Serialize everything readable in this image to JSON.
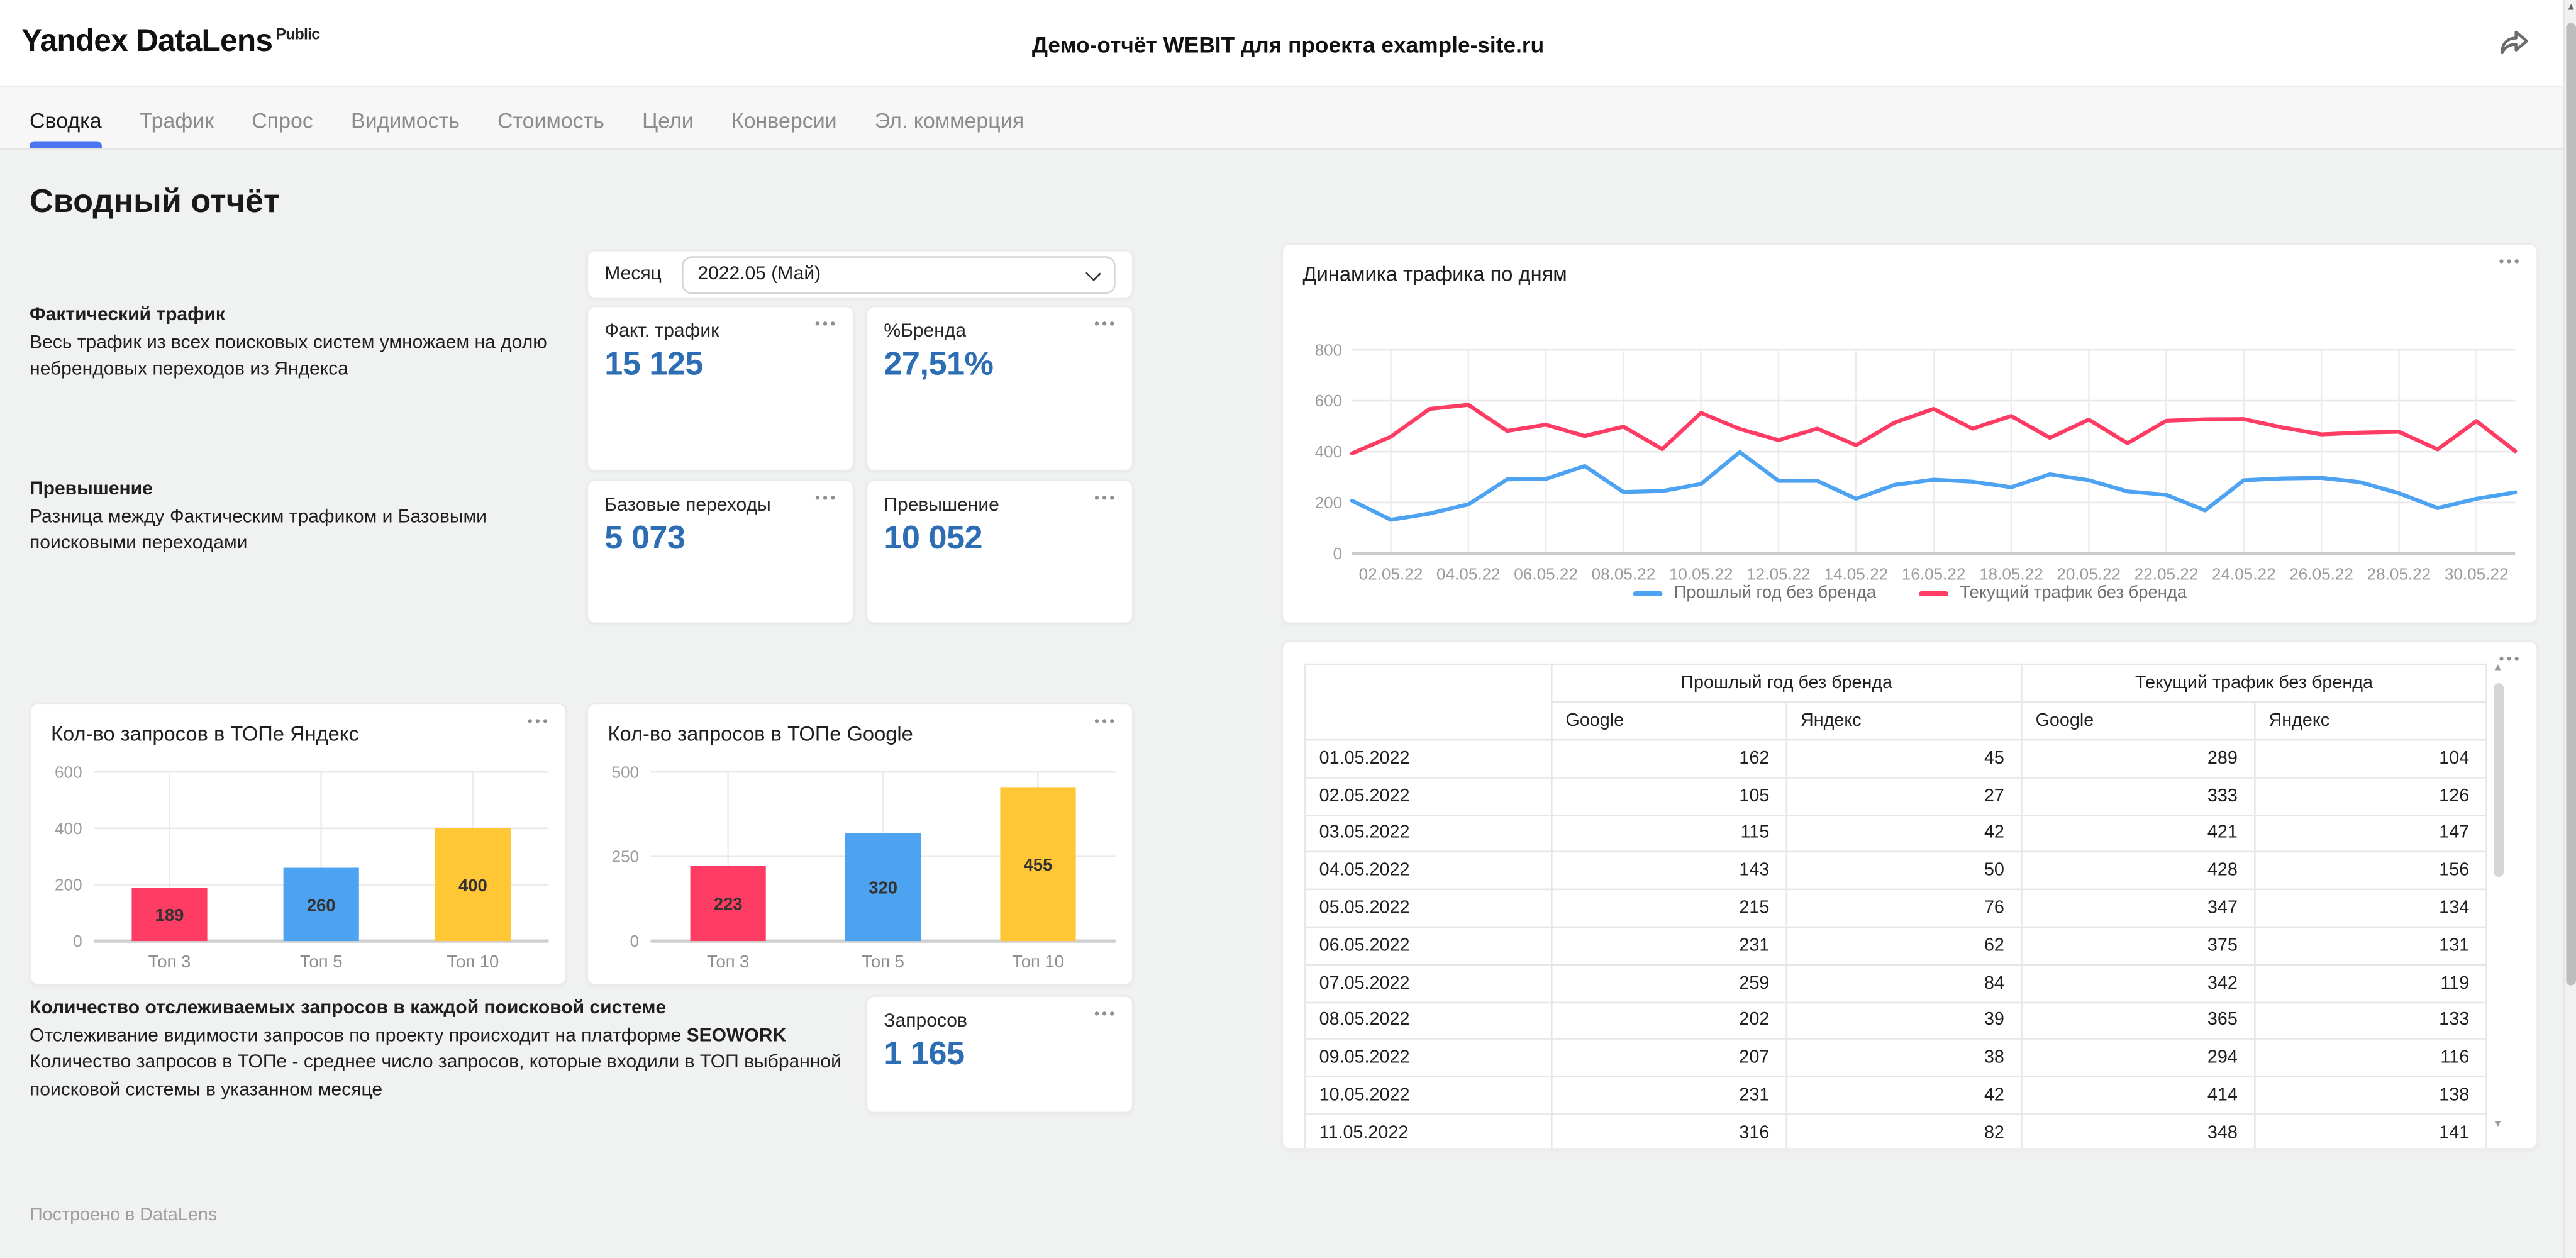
{
  "header": {
    "logo": "Yandex DataLens",
    "logo_badge": "Public",
    "title": "Демо-отчёт WEBIT для проекта example-site.ru"
  },
  "icons": {
    "more_menu": "•••",
    "chevron_down": "chevron-css-shape",
    "share": "curved-arrow-svg",
    "scroll_up": "▲",
    "scroll_down": "▼"
  },
  "colors": {
    "accent": "#4a74f0",
    "kpi_value": "#2c6db4",
    "series_blue": "#4DA2F1",
    "series_red": "#FF3D64",
    "series_yellow": "#FFC636"
  },
  "tabs": [
    {
      "label": "Сводка",
      "active": true
    },
    {
      "label": "Трафик",
      "active": false
    },
    {
      "label": "Спрос",
      "active": false
    },
    {
      "label": "Видимость",
      "active": false
    },
    {
      "label": "Стоимость",
      "active": false
    },
    {
      "label": "Цели",
      "active": false
    },
    {
      "label": "Конверсии",
      "active": false
    },
    {
      "label": "Эл. коммерция",
      "active": false
    }
  ],
  "page_title": "Сводный отчёт",
  "filter": {
    "label": "Месяц",
    "value": "2022.05 (Май)"
  },
  "notes": {
    "fact": {
      "title": "Фактический трафик",
      "body": "Весь трафик из всех поисковых систем умножаем на долю небрендовых переходов из Яндекса"
    },
    "exceed": {
      "title": "Превышение",
      "body": "Разница между Фактическим трафиком и Базовыми поисковыми переходами"
    },
    "queries": {
      "title": "Количество отслеживаемых запросов в каждой поисковой системе",
      "body_prefix": "Отслеживание видимости запросов по проекту происходит на платформе ",
      "body_bold": "SEOWORK",
      "body_rest": "Количество запросов в ТОПе - среднее число запросов, которые входили в ТОП выбранной поисковой системы в указанном месяце"
    }
  },
  "kpi_fact": {
    "label": "Факт. трафик",
    "value": "15 125"
  },
  "kpi_brand": {
    "label": "%Бренда",
    "value": "27,51%"
  },
  "kpi_base": {
    "label": "Базовые переходы",
    "value": "5 073"
  },
  "kpi_exceed": {
    "label": "Превышение",
    "value": "10 052"
  },
  "kpi_queries": {
    "label": "Запросов",
    "value": "1 165"
  },
  "chart_data": [
    {
      "type": "line",
      "title": "Динамика трафика по дням",
      "x": [
        "01.05.22",
        "02.05.22",
        "03.05.22",
        "04.05.22",
        "05.05.22",
        "06.05.22",
        "07.05.22",
        "08.05.22",
        "09.05.22",
        "10.05.22",
        "11.05.22",
        "12.05.22",
        "13.05.22",
        "14.05.22",
        "15.05.22",
        "16.05.22",
        "17.05.22",
        "18.05.22",
        "19.05.22",
        "20.05.22",
        "21.05.22",
        "22.05.22",
        "23.05.22",
        "24.05.22",
        "25.05.22",
        "26.05.22",
        "27.05.22",
        "28.05.22",
        "29.05.22",
        "30.05.22",
        "31.05.22"
      ],
      "x_tick_labels": [
        "02.05.22",
        "04.05.22",
        "06.05.22",
        "08.05.22",
        "10.05.22",
        "12.05.22",
        "14.05.22",
        "16.05.22",
        "18.05.22",
        "20.05.22",
        "22.05.22",
        "24.05.22",
        "26.05.22",
        "28.05.22",
        "30.05.22"
      ],
      "series": [
        {
          "name": "Прошлый год без бренда",
          "color": "#4DA2F1",
          "values": [
            207,
            132,
            157,
            193,
            291,
            293,
            343,
            241,
            245,
            273,
            398,
            285,
            285,
            215,
            270,
            290,
            282,
            260,
            311,
            288,
            244,
            230,
            169,
            288,
            295,
            297,
            280,
            237,
            178,
            215,
            240
          ]
        },
        {
          "name": "Текущий трафик без бренда",
          "color": "#FF3D64",
          "values": [
            393,
            459,
            568,
            584,
            481,
            506,
            461,
            498,
            410,
            552,
            489,
            445,
            490,
            425,
            515,
            568,
            490,
            540,
            454,
            526,
            433,
            521,
            527,
            528,
            495,
            468,
            475,
            478,
            409,
            520,
            402
          ]
        }
      ],
      "ylim": [
        0,
        800
      ],
      "yticks": [
        0,
        200,
        400,
        600,
        800
      ],
      "grid": true,
      "legend_position": "bottom"
    },
    {
      "type": "bar",
      "title": "Кол-во запросов в ТОПе Яндекс",
      "categories": [
        "Топ 3",
        "Топ 5",
        "Топ 10"
      ],
      "values": [
        189,
        260,
        400
      ],
      "bar_colors": [
        "#FF3D64",
        "#4DA2F1",
        "#FFC636"
      ],
      "ylim": [
        0,
        600
      ],
      "yticks": [
        0,
        200,
        400,
        600
      ]
    },
    {
      "type": "bar",
      "title": "Кол-во запросов в ТОПе Google",
      "categories": [
        "Топ 3",
        "Топ 5",
        "Топ 10"
      ],
      "values": [
        223,
        320,
        455
      ],
      "bar_colors": [
        "#FF3D64",
        "#4DA2F1",
        "#FFC636"
      ],
      "ylim": [
        0,
        500
      ],
      "yticks": [
        0,
        250,
        500
      ]
    },
    {
      "type": "table",
      "column_groups": [
        "",
        "Прошлый год без бренда",
        "Текущий трафик без бренда"
      ],
      "columns": [
        "",
        "Google",
        "Яндекс",
        "Google",
        "Яндекс"
      ],
      "rows": [
        [
          "01.05.2022",
          "162",
          "45",
          "289",
          "104"
        ],
        [
          "02.05.2022",
          "105",
          "27",
          "333",
          "126"
        ],
        [
          "03.05.2022",
          "115",
          "42",
          "421",
          "147"
        ],
        [
          "04.05.2022",
          "143",
          "50",
          "428",
          "156"
        ],
        [
          "05.05.2022",
          "215",
          "76",
          "347",
          "134"
        ],
        [
          "06.05.2022",
          "231",
          "62",
          "375",
          "131"
        ],
        [
          "07.05.2022",
          "259",
          "84",
          "342",
          "119"
        ],
        [
          "08.05.2022",
          "202",
          "39",
          "365",
          "133"
        ],
        [
          "09.05.2022",
          "207",
          "38",
          "294",
          "116"
        ],
        [
          "10.05.2022",
          "231",
          "42",
          "414",
          "138"
        ],
        [
          "11.05.2022",
          "316",
          "82",
          "348",
          "141"
        ]
      ]
    }
  ],
  "footer": "Построено в DataLens"
}
